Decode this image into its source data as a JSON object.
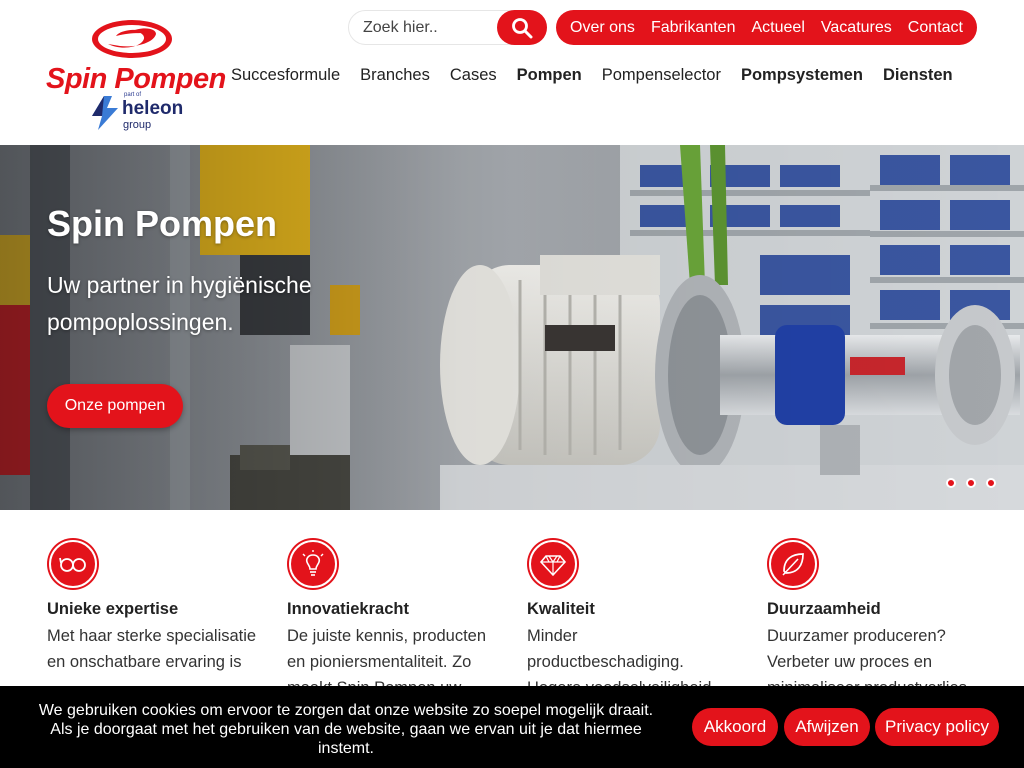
{
  "logo": {
    "name": "Spin Pompen",
    "partof": "part of",
    "heleon": "heleon",
    "group": "group"
  },
  "search": {
    "placeholder": "Zoek hier.."
  },
  "topnav": [
    "Over ons",
    "Fabrikanten",
    "Actueel",
    "Vacatures",
    "Contact"
  ],
  "mainnav": [
    {
      "label": "Succesformule",
      "bold": false
    },
    {
      "label": "Branches",
      "bold": false
    },
    {
      "label": "Cases",
      "bold": false
    },
    {
      "label": "Pompen",
      "bold": true
    },
    {
      "label": "Pompenselector",
      "bold": false
    },
    {
      "label": "Pompsystemen",
      "bold": true
    },
    {
      "label": "Diensten",
      "bold": true
    }
  ],
  "hero": {
    "title": "Spin Pompen",
    "subtitle": "Uw partner in hygiënische pompoplossingen.",
    "button": "Onze pompen",
    "slides": 3
  },
  "features": [
    {
      "icon": "glasses-icon",
      "title": "Unieke expertise",
      "text": "Met haar sterke specialisatie en onschatbare ervaring is"
    },
    {
      "icon": "lightbulb-icon",
      "title": "Innovatiekracht",
      "text": "De juiste kennis, producten en pioniersmentaliteit. Zo maakt Spin Pompen uw"
    },
    {
      "icon": "diamond-icon",
      "title": "Kwaliteit",
      "text": "Minder productbeschadiging. Hogere voedselveiligheid."
    },
    {
      "icon": "leaf-icon",
      "title": "Duurzaamheid",
      "text": "Duurzamer produceren? Verbeter uw proces en minimaliseer productverlies"
    }
  ],
  "cookie": {
    "text": "We gebruiken cookies om ervoor te zorgen dat onze website zo soepel mogelijk draait. Als je doorgaat met het gebruiken van de website, gaan we ervan uit je dat hiermee instemt.",
    "accept": "Akkoord",
    "decline": "Afwijzen",
    "privacy": "Privacy policy"
  },
  "colors": {
    "brand": "#e3131b",
    "heleon": "#1f2a6b"
  }
}
